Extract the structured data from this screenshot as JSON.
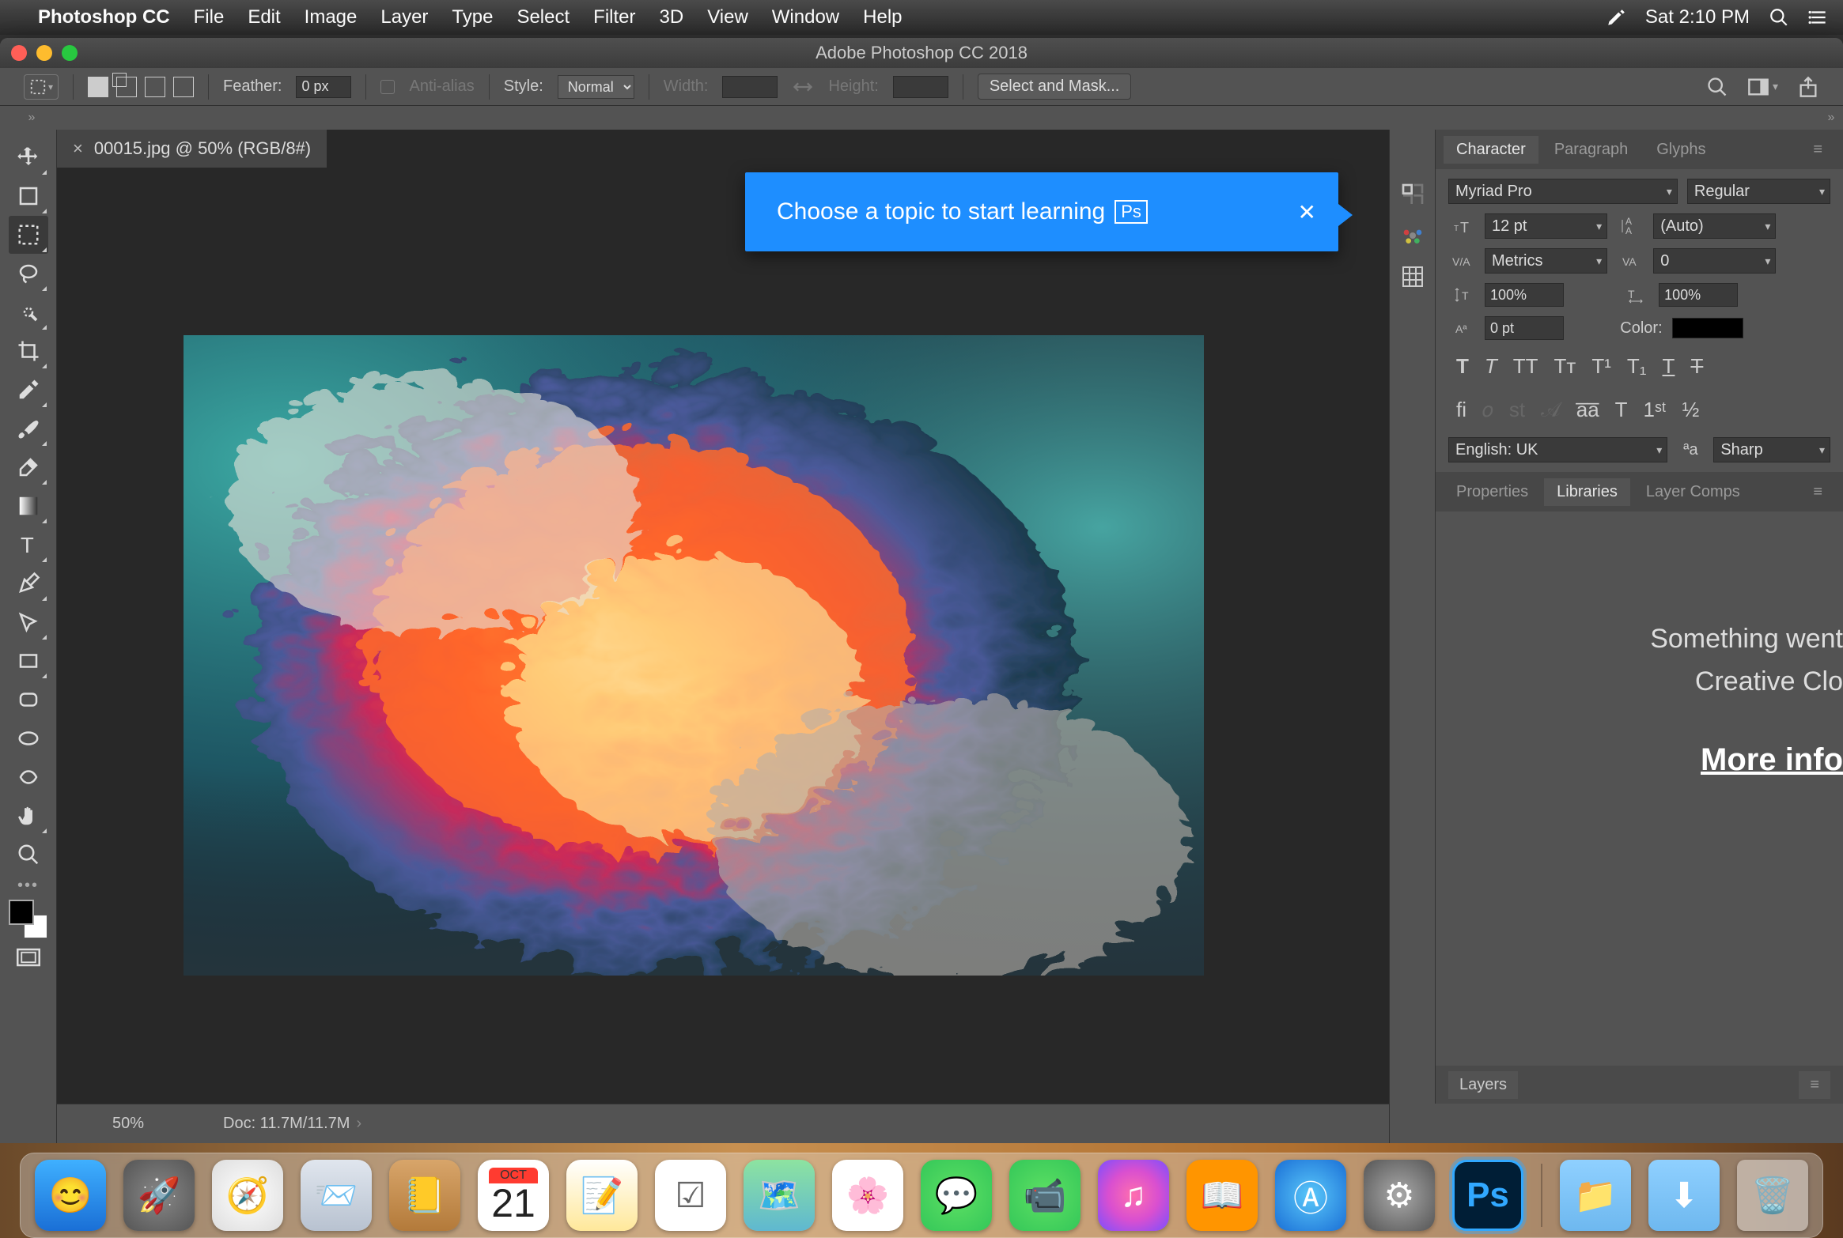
{
  "menubar": {
    "app": "Photoshop CC",
    "items": [
      "File",
      "Edit",
      "Image",
      "Layer",
      "Type",
      "Select",
      "Filter",
      "3D",
      "View",
      "Window",
      "Help"
    ],
    "clock": "Sat 2:10 PM"
  },
  "window": {
    "title": "Adobe Photoshop CC 2018"
  },
  "optionsbar": {
    "feather_label": "Feather:",
    "feather_value": "0 px",
    "antialias_label": "Anti-alias",
    "style_label": "Style:",
    "style_value": "Normal",
    "width_label": "Width:",
    "height_label": "Height:",
    "select_mask": "Select and Mask..."
  },
  "document": {
    "tab_label": "00015.jpg @ 50% (RGB/8#)"
  },
  "learn": {
    "text": "Choose a topic to start learning",
    "badge": "Ps"
  },
  "status": {
    "zoom": "50%",
    "doc": "Doc: 11.7M/11.7M"
  },
  "character": {
    "tabs": [
      "Character",
      "Paragraph",
      "Glyphs"
    ],
    "active_tab": "Character",
    "font": "Myriad Pro",
    "style": "Regular",
    "size": "12 pt",
    "leading": "(Auto)",
    "kerning": "Metrics",
    "tracking": "0",
    "vscale": "100%",
    "hscale": "100%",
    "baseline": "0 pt",
    "color_label": "Color:",
    "language": "English: UK",
    "aa": "Sharp"
  },
  "libraries": {
    "tabs": [
      "Properties",
      "Libraries",
      "Layer Comps"
    ],
    "active_tab": "Libraries",
    "line1": "Something went ",
    "line2": "Creative Clo",
    "link": "More info"
  },
  "layers": {
    "tab": "Layers"
  },
  "dock": {
    "cal_month": "OCT",
    "cal_day": "21"
  }
}
